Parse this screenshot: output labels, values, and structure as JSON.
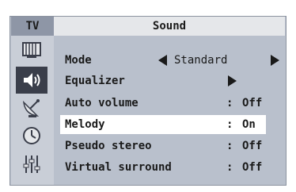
{
  "header": {
    "source_label": "TV",
    "title": "Sound"
  },
  "sidebar": {
    "icons": [
      {
        "name": "picture-icon"
      },
      {
        "name": "sound-icon",
        "active": true
      },
      {
        "name": "channel-icon"
      },
      {
        "name": "setup-icon"
      },
      {
        "name": "input-icon"
      }
    ]
  },
  "menu": {
    "items": [
      {
        "label": "Mode",
        "value": "Standard",
        "type": "selector"
      },
      {
        "label": "Equalizer",
        "value": "",
        "type": "submenu"
      },
      {
        "label": "Auto volume",
        "value": "Off",
        "type": "option"
      },
      {
        "label": "Melody",
        "value": "On",
        "type": "option",
        "selected": true
      },
      {
        "label": "Pseudo stereo",
        "value": "Off",
        "type": "option"
      },
      {
        "label": "Virtual surround",
        "value": "Off",
        "type": "option"
      }
    ],
    "separator": ":"
  },
  "colors": {
    "frame": "#b9c0cc",
    "title_bar": "#e5e7ea",
    "source_label_bg": "#8e96a6",
    "active_icon_bg": "#3a3e4a",
    "selected_row": "#ffffff",
    "text": "#1a1a1a"
  }
}
